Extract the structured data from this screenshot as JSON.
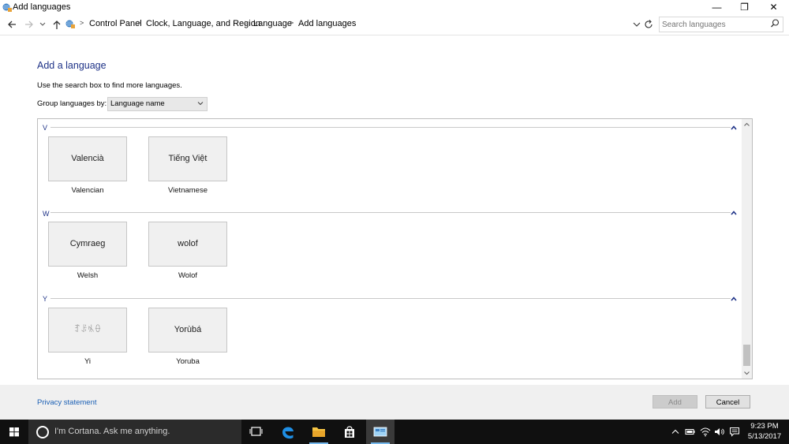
{
  "window": {
    "title": "Add languages",
    "buttons": {
      "minimize": "—",
      "maximize": "❐",
      "close": "✕"
    }
  },
  "navbar": {
    "breadcrumbs": [
      "Control Panel",
      "Clock, Language, and Region",
      "Language",
      "Add languages"
    ],
    "search": {
      "placeholder": "Search languages"
    }
  },
  "main": {
    "heading": "Add a language",
    "hint": "Use the search box to find more languages.",
    "group_by": {
      "label": "Group languages by:",
      "value": "Language name"
    },
    "sections": [
      {
        "letter": "V",
        "languages": [
          {
            "native": "Valencià",
            "name": "Valencian"
          },
          {
            "native": "Tiếng Việt",
            "name": "Vietnamese"
          }
        ]
      },
      {
        "letter": "W",
        "languages": [
          {
            "native": "Cymraeg",
            "name": "Welsh"
          },
          {
            "native": "wolof",
            "name": "Wolof"
          }
        ]
      },
      {
        "letter": "Y",
        "languages": [
          {
            "native": "ꆈꌠꁱꂷ",
            "name": "Yi"
          },
          {
            "native": "Yorùbá",
            "name": "Yoruba"
          }
        ]
      }
    ]
  },
  "footer": {
    "privacy": "Privacy statement",
    "add": "Add",
    "cancel": "Cancel"
  },
  "taskbar": {
    "cortana": "I'm Cortana. Ask me anything.",
    "time": "9:23 PM",
    "date": "5/13/2017",
    "accent": "#76b9ed"
  }
}
